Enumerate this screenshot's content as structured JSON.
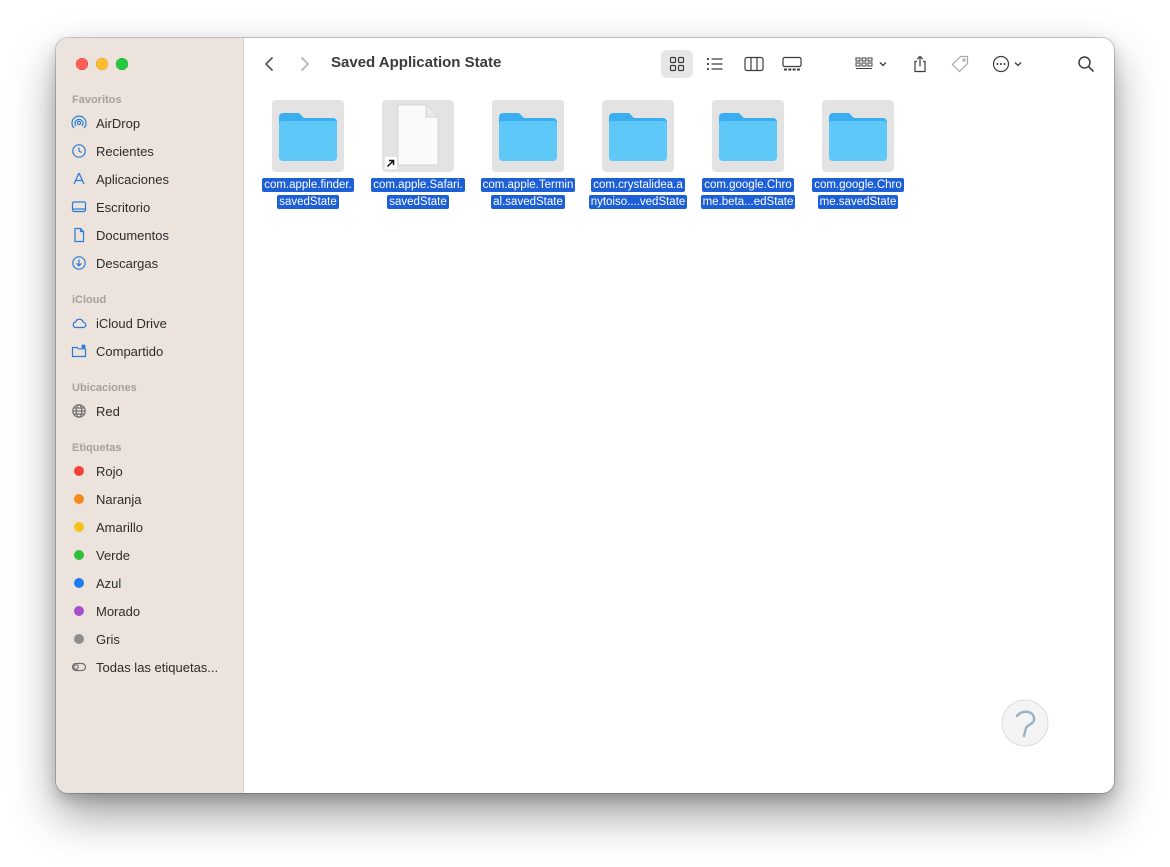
{
  "window": {
    "title": "Saved Application State"
  },
  "sidebar": {
    "sections": {
      "favorites": "Favoritos",
      "icloud": "iCloud",
      "locations": "Ubicaciones",
      "tags": "Etiquetas"
    },
    "favorites": [
      {
        "label": "AirDrop",
        "icon": "airdrop-icon"
      },
      {
        "label": "Recientes",
        "icon": "clock-icon"
      },
      {
        "label": "Aplicaciones",
        "icon": "applications-icon"
      },
      {
        "label": "Escritorio",
        "icon": "desktop-icon"
      },
      {
        "label": "Documentos",
        "icon": "document-icon"
      },
      {
        "label": "Descargas",
        "icon": "download-icon"
      }
    ],
    "icloud": [
      {
        "label": "iCloud Drive",
        "icon": "cloud-icon"
      },
      {
        "label": "Compartido",
        "icon": "shared-folder-icon"
      }
    ],
    "locations": [
      {
        "label": "Red",
        "icon": "globe-icon"
      }
    ],
    "tags": [
      {
        "label": "Rojo",
        "color": "#f24237"
      },
      {
        "label": "Naranja",
        "color": "#f48a1c"
      },
      {
        "label": "Amarillo",
        "color": "#f4c21a"
      },
      {
        "label": "Verde",
        "color": "#2fbf3c"
      },
      {
        "label": "Azul",
        "color": "#1f7bf2"
      },
      {
        "label": "Morado",
        "color": "#a64fcd"
      },
      {
        "label": "Gris",
        "color": "#8e8e91"
      },
      {
        "label": "Todas las etiquetas...",
        "icon": "all-tags-icon"
      }
    ]
  },
  "files": [
    {
      "line1": "com.apple.finder.",
      "line2": "savedState",
      "type": "folder"
    },
    {
      "line1": "com.apple.Safari.",
      "line2": "savedState",
      "type": "alias"
    },
    {
      "line1": "com.apple.Termin",
      "line2": "al.savedState",
      "type": "folder"
    },
    {
      "line1": "com.crystalidea.a",
      "line2": "nytoiso....vedState",
      "type": "folder"
    },
    {
      "line1": "com.google.Chro",
      "line2": "me.beta...edState",
      "type": "folder"
    },
    {
      "line1": "com.google.Chro",
      "line2": "me.savedState",
      "type": "folder"
    }
  ],
  "colors": {
    "selection": "#1d5fd7",
    "folder": "#5ec8f8",
    "sidebar_bg": "#ebe3dc"
  }
}
